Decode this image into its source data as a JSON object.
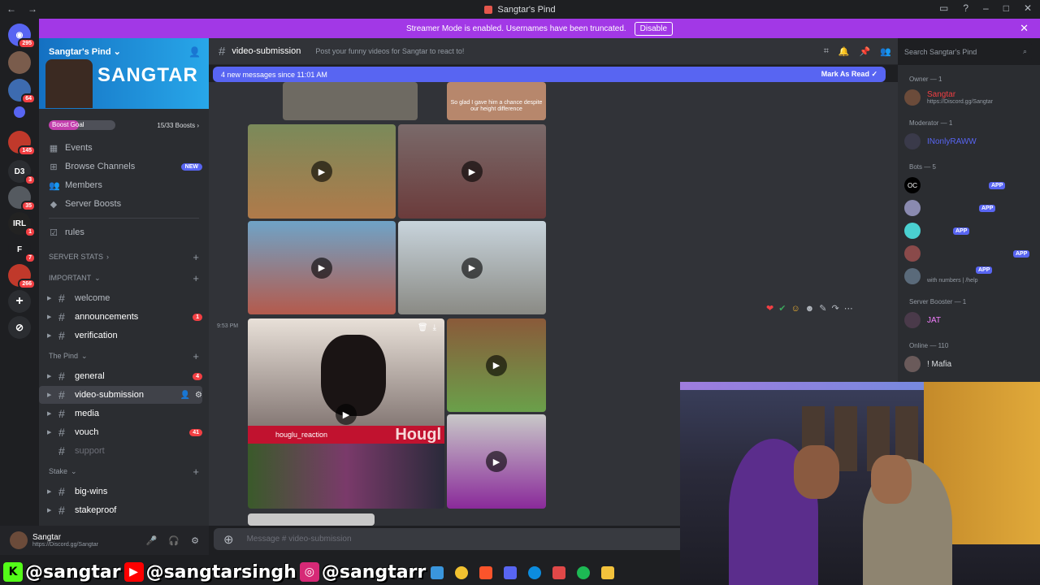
{
  "window": {
    "title": "Sangtar's Pind"
  },
  "streamer": {
    "text": "Streamer Mode is enabled. Usernames have been truncated.",
    "disable": "Disable"
  },
  "server": {
    "name": "Sangtar's Pind",
    "banner": "SANGTAR"
  },
  "server_badges": [
    "295",
    "64",
    "145",
    "3",
    "35",
    "1",
    "7",
    "266"
  ],
  "server_labels": {
    "d3": "D3",
    "irl": "IRL",
    "f": "F"
  },
  "boost": {
    "goal": "Boost Goal",
    "count": "15/33 Boosts",
    "progress": 0.45
  },
  "menu": {
    "events": "Events",
    "browse": "Browse Channels",
    "new": "NEW",
    "members": "Members",
    "boosts": "Server Boosts"
  },
  "channels": {
    "rules": "rules",
    "cat_stats": "SERVER STATS",
    "cat_important": "IMPORTANT",
    "welcome": "welcome",
    "announcements": "announcements",
    "announcements_badge": "1",
    "verification": "verification",
    "cat_pind": "The Pind",
    "general": "general",
    "general_badge": "4",
    "video": "video-submission",
    "media": "media",
    "vouch": "vouch",
    "vouch_badge": "41",
    "support": "support",
    "cat_stake": "Stake",
    "bigwins": "big-wins",
    "stakeproof": "stakeproof"
  },
  "user": {
    "name": "Sangtar",
    "status": "https://Discord.gg/Sangtar"
  },
  "header": {
    "channel": "video-submission",
    "topic": "Post your funny videos for Sangtar to react to!"
  },
  "search": {
    "placeholder": "Search Sangtar's Pind"
  },
  "newmsg": {
    "text": "4 new messages since 11:01 AM",
    "mark": "Mark As Read"
  },
  "chat": {
    "timestamp": "9:53 PM",
    "insta_handle": "houglu_reaction",
    "insta_big": "Hougl",
    "thumb_caption": "So glad I gave him a chance despite our height difference"
  },
  "composer": {
    "placeholder": "Message # video-submission"
  },
  "members": {
    "owner_cat": "Owner — 1",
    "owner": "Sangtar",
    "owner_sub": "https://Discord.gg/Sangtar",
    "mod_cat": "Moderator — 1",
    "mod": "INonlyRAWW",
    "bots_cat": "Bots — 5",
    "app": "APP",
    "bot_sub": "with numbers | /help",
    "bot_oc": "OC",
    "booster_cat": "Server Booster — 1",
    "booster": "JAT",
    "online_cat": "Online — 110",
    "online1": "! Mafia"
  },
  "social": {
    "kick": "@sangtar",
    "youtube": "@sangtarsingh",
    "instagram": "@sangtarr"
  },
  "colors": {
    "accent": "#5865f2",
    "streamer": "#a238e6",
    "danger": "#f23f43",
    "owner": "#f23f43"
  }
}
